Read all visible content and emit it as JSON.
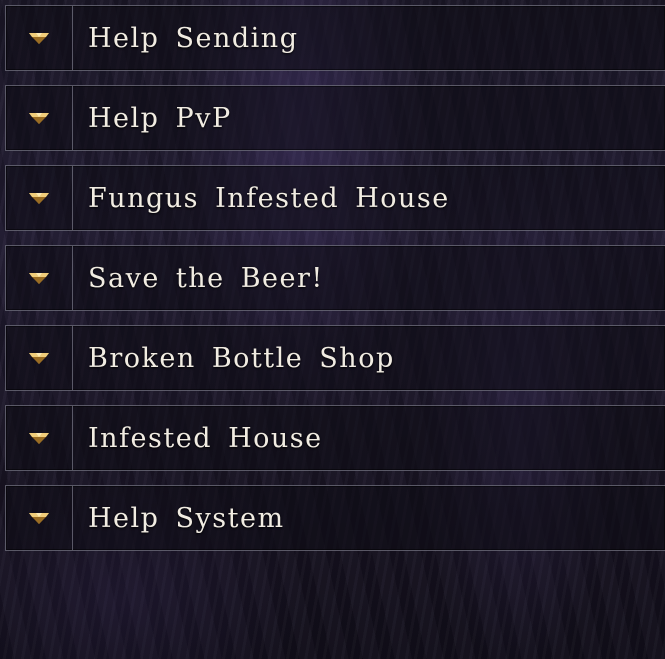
{
  "menu": {
    "items": [
      {
        "label": "Help Sending",
        "icon": "gold-gem-arrow-icon"
      },
      {
        "label": "Help PvP",
        "icon": "gold-gem-arrow-icon"
      },
      {
        "label": "Fungus Infested House",
        "icon": "gold-gem-arrow-icon"
      },
      {
        "label": "Save the Beer!",
        "icon": "gold-gem-arrow-icon"
      },
      {
        "label": "Broken Bottle Shop",
        "icon": "gold-gem-arrow-icon"
      },
      {
        "label": "Infested House",
        "icon": "gold-gem-arrow-icon"
      },
      {
        "label": "Help System",
        "icon": "gold-gem-arrow-icon"
      }
    ]
  },
  "colors": {
    "label_text": "#f1ece2",
    "icon_gold": "#d9b15a",
    "border": "#9696a5"
  }
}
